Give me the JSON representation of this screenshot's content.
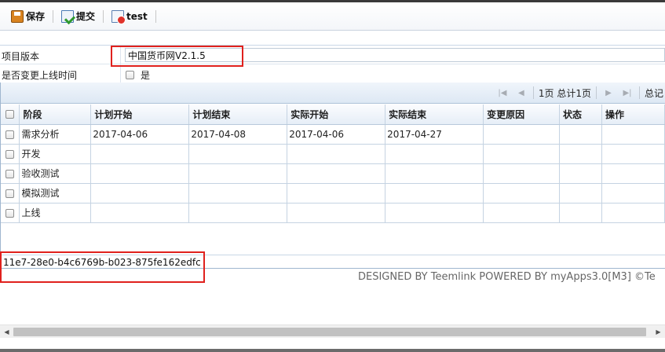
{
  "toolbar": {
    "save_label": "保存",
    "submit_label": "提交",
    "test_label": "test"
  },
  "form": {
    "version_label": "项目版本",
    "version_value": "中国货币网V2.1.5",
    "online_label": "是否变更上线时间",
    "online_option": "是"
  },
  "pager": {
    "page_info": "1页 总计1页",
    "total_label": "总记"
  },
  "grid": {
    "columns": [
      "阶段",
      "计划开始",
      "计划结束",
      "实际开始",
      "实际结束",
      "变更原因",
      "状态",
      "操作"
    ],
    "rows": [
      [
        "需求分析",
        "2017-04-06",
        "2017-04-08",
        "2017-04-06",
        "2017-04-27",
        "",
        "",
        ""
      ],
      [
        "开发",
        "",
        "",
        "",
        "",
        "",
        "",
        ""
      ],
      [
        "验收测试",
        "",
        "",
        "",
        "",
        "",
        "",
        ""
      ],
      [
        "模拟测试",
        "",
        "",
        "",
        "",
        "",
        "",
        ""
      ],
      [
        "上线",
        "",
        "",
        "",
        "",
        "",
        "",
        ""
      ]
    ]
  },
  "record_id": "11e7-28e0-b4c6769b-b023-875fe162edfc",
  "footer": "DESIGNED BY Teemlink POWERED BY myApps3.0[M3] ©Te",
  "colors": {
    "highlight": "#e0211d",
    "grid_border": "#c5d3e2",
    "header_bg": "#e6eef7"
  }
}
